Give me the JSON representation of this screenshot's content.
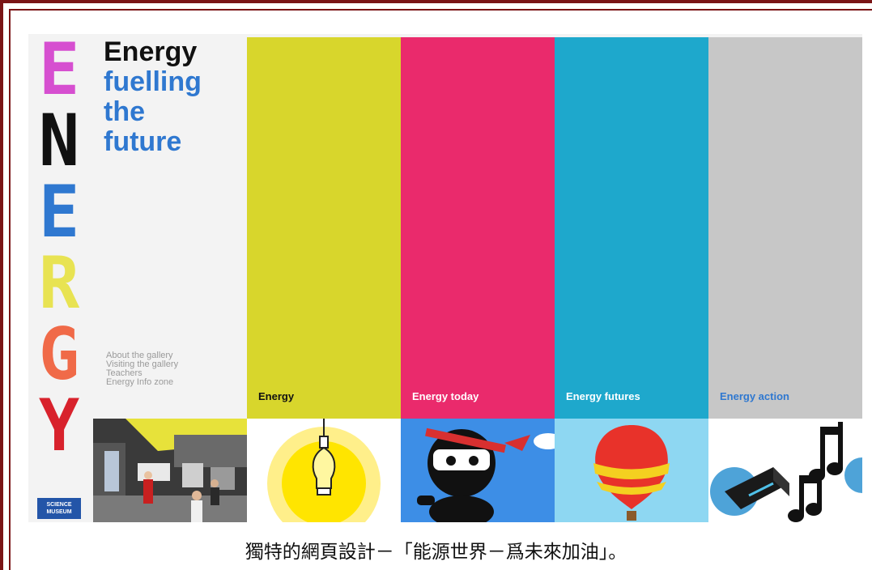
{
  "letters": [
    {
      "char": "E",
      "color": "#d64fd0"
    },
    {
      "char": "N",
      "color": "#111111"
    },
    {
      "char": "E",
      "color": "#2f78d0"
    },
    {
      "char": "R",
      "color": "#e8e352"
    },
    {
      "char": "G",
      "color": "#f06a48"
    },
    {
      "char": "Y",
      "color": "#d8222c"
    }
  ],
  "title": {
    "line1": "Energy",
    "line2": "fuelling",
    "line3": "the",
    "line4": "future"
  },
  "nav_links": [
    "About the gallery",
    "Visiting the gallery",
    "Teachers",
    "Energy Info zone"
  ],
  "logo_text": "SCIENCE MUSEUM",
  "columns": [
    {
      "label": "Energy",
      "bg": "#d8d62c",
      "label_color": "#111111",
      "tile_icon": "lightbulb-icon"
    },
    {
      "label": "Energy today",
      "bg": "#ea2a6c",
      "label_color": "#ffffff",
      "tile_icon": "ninja-icon"
    },
    {
      "label": "Energy futures",
      "bg": "#1ea8cc",
      "label_color": "#ffffff",
      "tile_icon": "hot-air-balloon-icon"
    },
    {
      "label": "Energy action",
      "bg": "#c7c7c7",
      "label_color": "#2f78d0",
      "tile_icon": "music-notes-icon"
    }
  ],
  "caption": "獨特的網頁設計－「能源世界－爲未來加油」。"
}
